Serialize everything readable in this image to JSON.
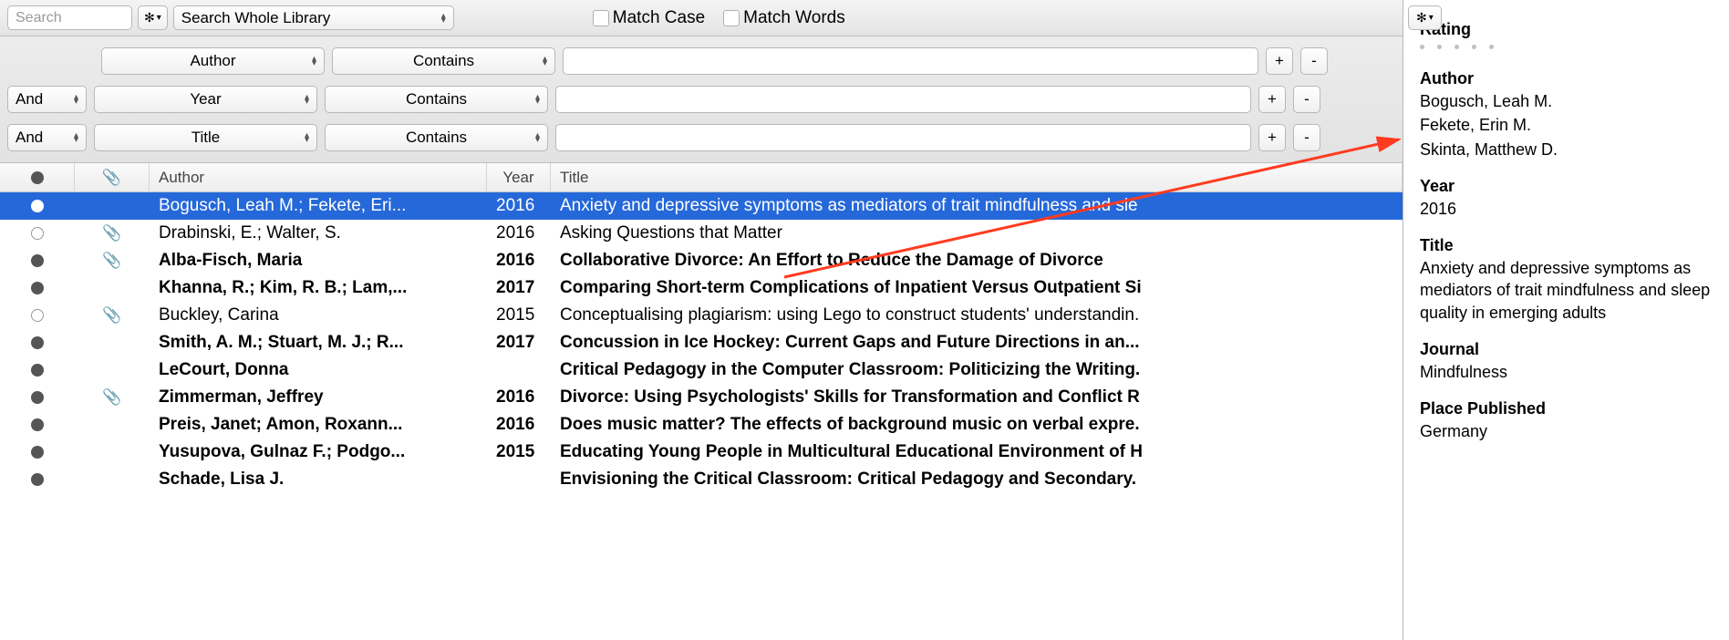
{
  "toolbar": {
    "search_placeholder": "Search",
    "scope": "Search Whole Library",
    "match_case": "Match Case",
    "match_words": "Match Words"
  },
  "filters": [
    {
      "bool": "",
      "field": "Author",
      "op": "Contains",
      "value": ""
    },
    {
      "bool": "And",
      "field": "Year",
      "op": "Contains",
      "value": ""
    },
    {
      "bool": "And",
      "field": "Title",
      "op": "Contains",
      "value": ""
    }
  ],
  "columns": {
    "author": "Author",
    "year": "Year",
    "title": "Title"
  },
  "rows": [
    {
      "read": "sel",
      "att": false,
      "author": "Bogusch, Leah M.; Fekete, Eri...",
      "year": "2016",
      "title": "Anxiety and depressive symptoms as mediators of trait mindfulness and sle",
      "bold": false,
      "selected": true
    },
    {
      "read": "open",
      "att": true,
      "author": "Drabinski, E.; Walter, S.",
      "year": "2016",
      "title": "Asking Questions that Matter",
      "bold": false,
      "selected": false
    },
    {
      "read": "filled",
      "att": true,
      "author": "Alba-Fisch, Maria",
      "year": "2016",
      "title": "Collaborative Divorce: An Effort to Reduce the Damage of Divorce",
      "bold": true,
      "selected": false
    },
    {
      "read": "filled",
      "att": false,
      "author": "Khanna, R.; Kim, R. B.; Lam,...",
      "year": "2017",
      "title": "Comparing Short-term Complications of Inpatient Versus Outpatient Si",
      "bold": true,
      "selected": false
    },
    {
      "read": "open",
      "att": true,
      "author": "Buckley, Carina",
      "year": "2015",
      "title": "Conceptualising plagiarism: using Lego to construct students' understandin.",
      "bold": false,
      "selected": false
    },
    {
      "read": "filled",
      "att": false,
      "author": "Smith, A. M.; Stuart, M. J.; R...",
      "year": "2017",
      "title": "Concussion in Ice Hockey: Current Gaps and Future Directions in an...",
      "bold": true,
      "selected": false
    },
    {
      "read": "filled",
      "att": false,
      "author": "LeCourt, Donna",
      "year": "",
      "title": "Critical Pedagogy in the Computer Classroom: Politicizing the Writing.",
      "bold": true,
      "selected": false
    },
    {
      "read": "filled",
      "att": true,
      "author": "Zimmerman, Jeffrey",
      "year": "2016",
      "title": "Divorce: Using Psychologists' Skills for Transformation and Conflict R",
      "bold": true,
      "selected": false
    },
    {
      "read": "filled",
      "att": false,
      "author": "Preis, Janet; Amon, Roxann...",
      "year": "2016",
      "title": "Does music matter? The effects of background music on verbal expre.",
      "bold": true,
      "selected": false
    },
    {
      "read": "filled",
      "att": false,
      "author": "Yusupova, Gulnaz F.; Podgo...",
      "year": "2015",
      "title": "Educating Young People in Multicultural Educational Environment of H",
      "bold": true,
      "selected": false
    },
    {
      "read": "filled",
      "att": false,
      "author": "Schade, Lisa J.",
      "year": "",
      "title": "Envisioning the Critical Classroom: Critical Pedagogy and Secondary.",
      "bold": true,
      "selected": false
    }
  ],
  "detail": {
    "rating_label": "Rating",
    "author_label": "Author",
    "authors": [
      "Bogusch, Leah M.",
      "Fekete, Erin M.",
      "Skinta, Matthew D."
    ],
    "year_label": "Year",
    "year": "2016",
    "title_label": "Title",
    "title": "Anxiety and depressive symptoms as mediators of trait mindfulness and sleep quality in emerging adults",
    "journal_label": "Journal",
    "journal": "Mindfulness",
    "place_label": "Place Published",
    "place": "Germany"
  }
}
